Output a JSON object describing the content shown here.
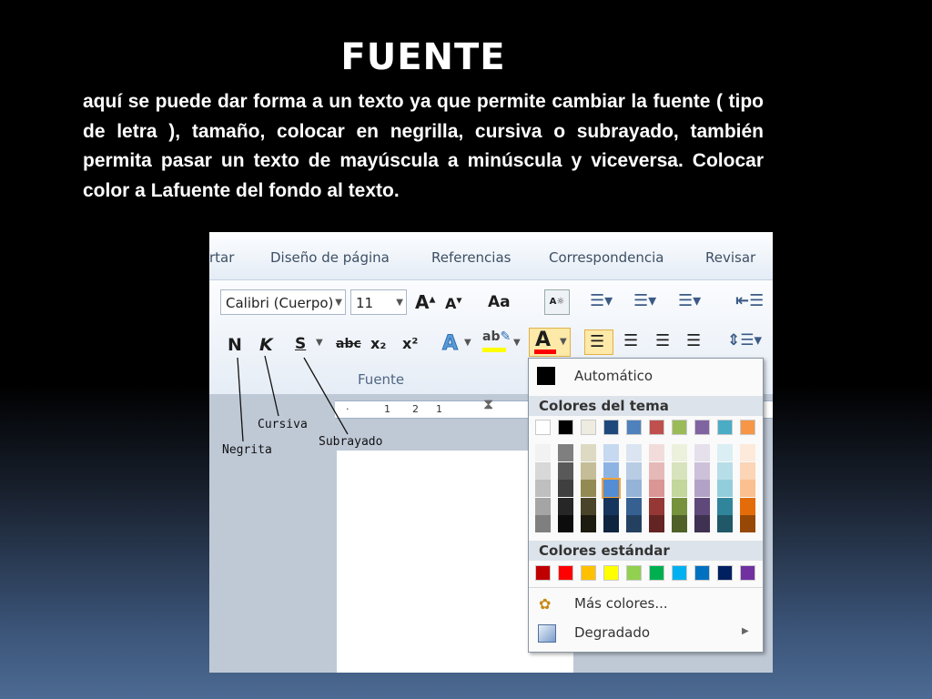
{
  "slide": {
    "title": "FUENTE",
    "body": "aquí se puede dar forma a  un texto ya que permite cambiar la fuente ( tipo de letra ), tamaño, colocar en negrilla, cursiva o subrayado, también permita pasar un texto de mayúscula a minúscula y viceversa. Colocar color a Lafuente del fondo al texto."
  },
  "ribbon": {
    "tabs": [
      "rtar",
      "Diseño de página",
      "Referencias",
      "Correspondencia",
      "Revisar"
    ],
    "font_name": "Calibri (Cuerpo)",
    "font_size": "11",
    "bold": "N",
    "italic": "K",
    "underline": "S",
    "strike": "abc",
    "subscript": "x₂",
    "superscript": "x²",
    "case": "Aa",
    "group_label": "Fuente"
  },
  "ruler": [
    "1",
    "2",
    "1"
  ],
  "annotations": {
    "negrita": "Negrita",
    "cursiva": "Cursiva",
    "subrayado": "Subrayado"
  },
  "color_menu": {
    "automatic": "Automático",
    "theme_header": "Colores del tema",
    "standard_header": "Colores estándar",
    "more_colors": "Más colores...",
    "gradient": "Degradado",
    "theme_top": [
      "#ffffff",
      "#000000",
      "#eeece1",
      "#1f497d",
      "#4f81bd",
      "#c0504d",
      "#9bbb59",
      "#8064a2",
      "#4bacc6",
      "#f79646"
    ],
    "theme_shades": [
      [
        "#f2f2f2",
        "#d8d8d8",
        "#bfbfbf",
        "#a5a5a5",
        "#7f7f7f"
      ],
      [
        "#7f7f7f",
        "#595959",
        "#3f3f3f",
        "#262626",
        "#0c0c0c"
      ],
      [
        "#ddd9c3",
        "#c4bd97",
        "#938953",
        "#494429",
        "#1d1b10"
      ],
      [
        "#c6d9f0",
        "#8db3e2",
        "#548dd4",
        "#17365d",
        "#0f243e"
      ],
      [
        "#dbe5f1",
        "#b8cce4",
        "#95b3d7",
        "#366092",
        "#244061"
      ],
      [
        "#f2dcdb",
        "#e5b9b7",
        "#d99694",
        "#953734",
        "#632423"
      ],
      [
        "#ebf1dd",
        "#d7e3bc",
        "#c3d69b",
        "#76923c",
        "#4f6128"
      ],
      [
        "#e5e0ec",
        "#ccc1d9",
        "#b2a2c7",
        "#5f497a",
        "#3f3151"
      ],
      [
        "#dbeef3",
        "#b7dde8",
        "#92cddc",
        "#31859b",
        "#205867"
      ],
      [
        "#fdeada",
        "#fbd5b5",
        "#fac08f",
        "#e36c09",
        "#974806"
      ]
    ],
    "standard": [
      "#c00000",
      "#ff0000",
      "#ffc000",
      "#ffff00",
      "#92d050",
      "#00b050",
      "#00b0f0",
      "#0070c0",
      "#002060",
      "#7030a0"
    ],
    "font_color_accent": "#ff0000",
    "highlight_accent": "#ffff00"
  }
}
